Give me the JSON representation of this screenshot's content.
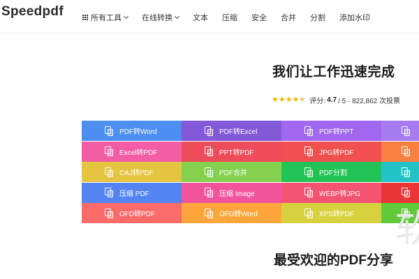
{
  "header": {
    "logo": "Speedpdf",
    "nav": [
      {
        "label": "所有工具",
        "has_grid": true,
        "has_chevron": true
      },
      {
        "label": "在线转换",
        "has_grid": false,
        "has_chevron": true
      },
      {
        "label": "文本",
        "has_grid": false,
        "has_chevron": false
      },
      {
        "label": "压缩",
        "has_grid": false,
        "has_chevron": false
      },
      {
        "label": "安全",
        "has_grid": false,
        "has_chevron": false
      },
      {
        "label": "合并",
        "has_grid": false,
        "has_chevron": false
      },
      {
        "label": "分割",
        "has_grid": false,
        "has_chevron": false
      },
      {
        "label": "添加水印",
        "has_grid": false,
        "has_chevron": false
      }
    ]
  },
  "hero": {
    "title": "我们让工作迅速完成",
    "rating": {
      "stars": 4.5,
      "prefix": "评分:",
      "score": "4.7",
      "suffix": "/ 5 - 822,862 次投票"
    }
  },
  "tools": {
    "rows": [
      [
        {
          "label": "PDF转Word",
          "color": "#4d8ff0"
        },
        {
          "label": "PDF转Excel",
          "color": "#8358d9"
        },
        {
          "label": "PDF转PPT",
          "color": "#a168ef"
        },
        {
          "label": "",
          "color": "#a67bf0"
        }
      ],
      [
        {
          "label": "Excel转PDF",
          "color": "#f25da6"
        },
        {
          "label": "PPT转PDF",
          "color": "#ee4b5b"
        },
        {
          "label": "JPG转PDF",
          "color": "#f1504e"
        },
        {
          "label": "",
          "color": "#f98041"
        }
      ],
      [
        {
          "label": "CAJ转PDF",
          "color": "#e5c53f"
        },
        {
          "label": "PDF合并",
          "color": "#84d14f"
        },
        {
          "label": "PDF分割",
          "color": "#24c356"
        },
        {
          "label": "",
          "color": "#22c2c6"
        }
      ],
      [
        {
          "label": "压缩 PDF",
          "color": "#5484f1"
        },
        {
          "label": "压缩 Image",
          "color": "#f1549d"
        },
        {
          "label": "WEBP转JPG",
          "color": "#f55372"
        },
        {
          "label": "",
          "color": "#ea3436"
        }
      ],
      [
        {
          "label": "OFD转PDF",
          "color": "#fb6b6a"
        },
        {
          "label": "OFD转Word",
          "color": "#fea53b"
        },
        {
          "label": "XPS转PDF",
          "color": "#d8d13f"
        },
        {
          "label": "",
          "color": "#62c93b"
        }
      ]
    ]
  },
  "watermark": "软",
  "section": {
    "title": "最受欢迎的PDF分享"
  }
}
